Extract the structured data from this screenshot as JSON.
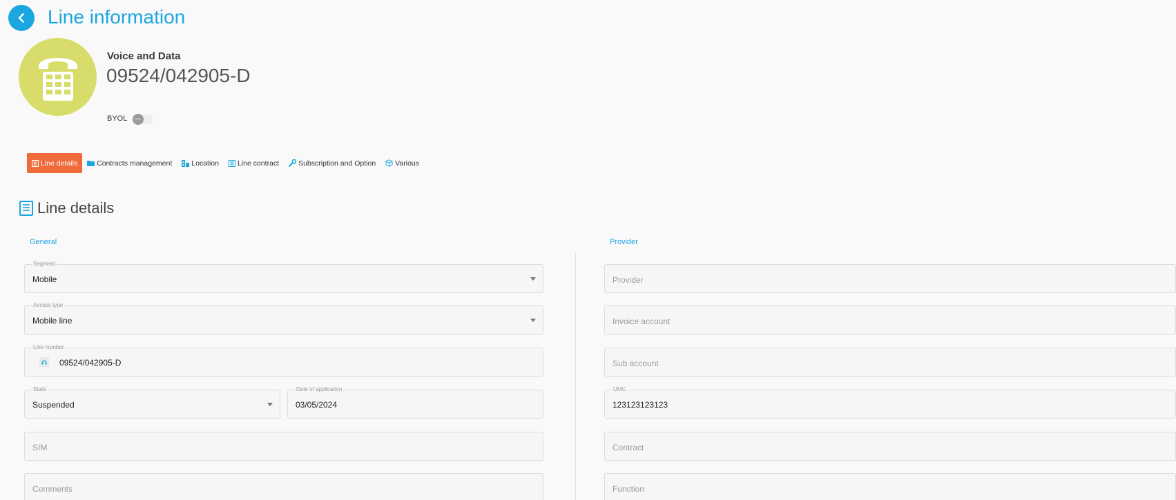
{
  "header": {
    "title": "Line information",
    "back_icon": "chevron-left-icon"
  },
  "line": {
    "type": "Voice and Data",
    "id": "09524/042905-D",
    "avatar_icon": "phone-icon",
    "avatar_color": "#d8dc6a",
    "byol_label": "BYOL",
    "byol_enabled": false
  },
  "tabs": [
    {
      "label": "Line details",
      "icon": "document-icon",
      "active": true
    },
    {
      "label": "Contracts management",
      "icon": "folder-icon",
      "active": false
    },
    {
      "label": "Location",
      "icon": "building-icon",
      "active": false
    },
    {
      "label": "Line contract",
      "icon": "document-icon",
      "active": false
    },
    {
      "label": "Subscription and Option",
      "icon": "wrench-icon",
      "active": false
    },
    {
      "label": "Various",
      "icon": "cube-icon",
      "active": false
    }
  ],
  "section": {
    "title": "Line details",
    "icon": "document-icon"
  },
  "general": {
    "label": "General",
    "segment": {
      "label": "Segment",
      "value": "Mobile"
    },
    "access_type": {
      "label": "Access type",
      "value": "Mobile line"
    },
    "line_number": {
      "label": "Line number",
      "value": "09524/042905-D"
    },
    "state": {
      "label": "State",
      "value": "Suspended"
    },
    "date_of_application": {
      "label": "Date of application",
      "value": "03/05/2024"
    },
    "sim": {
      "placeholder": "SIM"
    },
    "comments": {
      "placeholder": "Comments"
    }
  },
  "provider": {
    "label": "Provider",
    "provider": {
      "placeholder": "Provider"
    },
    "invoice_account": {
      "placeholder": "Invoice account"
    },
    "sub_account": {
      "placeholder": "Sub account"
    },
    "umc": {
      "label": "UMC",
      "value": "123123123123"
    },
    "contract": {
      "placeholder": "Contract"
    },
    "function": {
      "placeholder": "Function"
    }
  },
  "colors": {
    "accent": "#1aa7e0",
    "active_tab": "#f06a3c"
  }
}
